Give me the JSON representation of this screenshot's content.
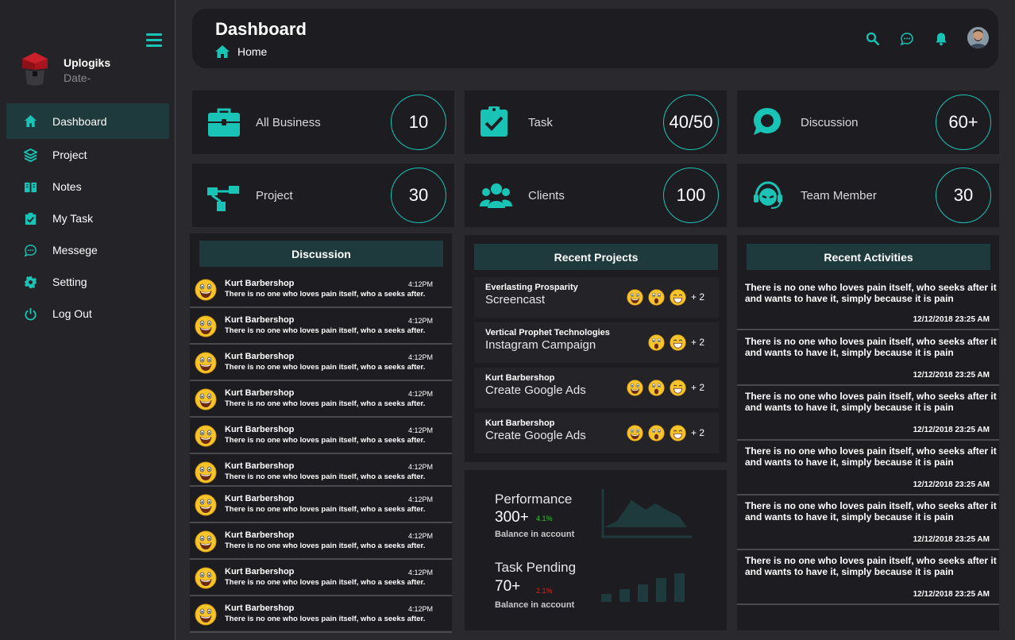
{
  "sidebar": {
    "brand_name": "Uplogiks",
    "brand_date": "Date-",
    "items": [
      {
        "label": "Dashboard",
        "icon": "home-icon"
      },
      {
        "label": "Project",
        "icon": "layers-icon"
      },
      {
        "label": "Notes",
        "icon": "book-icon"
      },
      {
        "label": "My Task",
        "icon": "clipboard-check-icon"
      },
      {
        "label": "Messege",
        "icon": "chat-icon"
      },
      {
        "label": "Setting",
        "icon": "gear-icon"
      },
      {
        "label": "Log Out",
        "icon": "power-icon"
      }
    ]
  },
  "header": {
    "title": "Dashboard",
    "breadcrumb": "Home"
  },
  "stats": [
    {
      "label": "All Business",
      "value": "10",
      "icon": "briefcase-icon"
    },
    {
      "label": "Task",
      "value": "40/50",
      "icon": "clipboard-check-icon"
    },
    {
      "label": "Discussion",
      "value": "60+",
      "icon": "chat-bubble-icon"
    },
    {
      "label": "Project",
      "value": "30",
      "icon": "workflow-icon"
    },
    {
      "label": "Clients",
      "value": "100",
      "icon": "users-icon"
    },
    {
      "label": "Team Member",
      "value": "30",
      "icon": "headset-icon"
    }
  ],
  "discussion": {
    "title": "Discussion",
    "items": [
      {
        "name": "Kurt Barbershop",
        "time": "4:12PM",
        "message": "There is no one who loves pain itself, who a seeks after."
      },
      {
        "name": "Kurt Barbershop",
        "time": "4:12PM",
        "message": "There is no one who loves pain itself, who a seeks after."
      },
      {
        "name": "Kurt Barbershop",
        "time": "4:12PM",
        "message": "There is no one who loves pain itself, who a seeks after."
      },
      {
        "name": "Kurt Barbershop",
        "time": "4:12PM",
        "message": "There is no one who loves pain itself, who a seeks after."
      },
      {
        "name": "Kurt Barbershop",
        "time": "4:12PM",
        "message": "There is no one who loves pain itself, who a seeks after."
      },
      {
        "name": "Kurt Barbershop",
        "time": "4:12PM",
        "message": "There is no one who loves pain itself, who a seeks after."
      },
      {
        "name": "Kurt Barbershop",
        "time": "4:12PM",
        "message": "There is no one who loves pain itself, who a seeks after."
      },
      {
        "name": "Kurt Barbershop",
        "time": "4:12PM",
        "message": "There is no one who loves pain itself, who a seeks after."
      },
      {
        "name": "Kurt Barbershop",
        "time": "4:12PM",
        "message": "There is no one who loves pain itself, who a seeks after."
      },
      {
        "name": "Kurt Barbershop",
        "time": "4:12PM",
        "message": "There is no one who loves pain itself, who a seeks after."
      }
    ]
  },
  "recent_projects": {
    "title": "Recent Projects",
    "items": [
      {
        "company": "Everlasting Prosparity",
        "title": "Screencast",
        "more": "+ 2",
        "emojis": [
          "grin",
          "shock",
          "smile"
        ]
      },
      {
        "company": "Vertical Prophet Technologies",
        "title": "Instagram Campaign",
        "more": "+ 2",
        "emojis": [
          "shock",
          "smile"
        ]
      },
      {
        "company": "Kurt Barbershop",
        "title": "Create Google Ads",
        "more": "+ 2",
        "emojis": [
          "grin",
          "shock",
          "smile"
        ]
      },
      {
        "company": "Kurt Barbershop",
        "title": "Create Google Ads",
        "more": "+ 2",
        "emojis": [
          "grin",
          "shock",
          "smile"
        ]
      }
    ]
  },
  "performance": {
    "title": "Performance",
    "value": "300+",
    "change": "4.1%",
    "subtitle": "Balance in account",
    "change_color": "#22cc22"
  },
  "task_pending": {
    "title": "Task Pending",
    "value": "70+",
    "change": "2.1%",
    "subtitle": "Balance in account",
    "change_color": "#dd2222"
  },
  "recent_activities": {
    "title": "Recent Activities",
    "items": [
      {
        "text": "There is no one who loves pain itself, who seeks after it and wants to have it, simply because it is pain",
        "time": "12/12/2018 23:25 AM"
      },
      {
        "text": "There is no one who loves pain itself, who seeks after it and wants to have it, simply because it is pain",
        "time": "12/12/2018 23:25 AM"
      },
      {
        "text": "There is no one who loves pain itself, who seeks after it and wants to have it, simply because it is pain",
        "time": "12/12/2018 23:25 AM"
      },
      {
        "text": "There is no one who loves pain itself, who seeks after it and wants to have it, simply because it is pain",
        "time": "12/12/2018 23:25 AM"
      },
      {
        "text": "There is no one who loves pain itself, who seeks after it and wants to have it, simply because it is pain",
        "time": "12/12/2018 23:25 AM"
      },
      {
        "text": "There is no one who loves pain itself, who seeks after it and wants to have it, simply because it is pain",
        "time": "12/12/2018 23:25 AM"
      }
    ]
  },
  "colors": {
    "accent": "#19c3b6",
    "panel": "#1d1d21",
    "panel_head": "#1f3a3c",
    "background": "#2a2a2e"
  }
}
